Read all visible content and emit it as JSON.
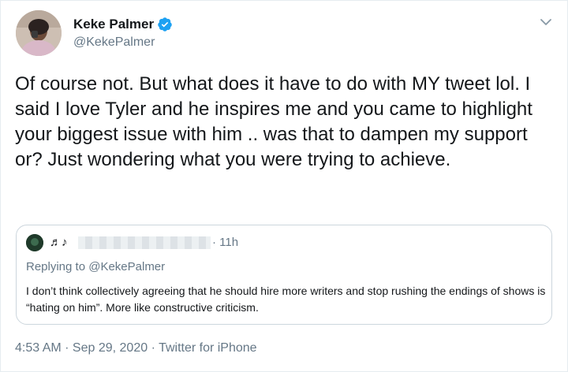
{
  "author": {
    "display_name": "Keke Palmer",
    "handle": "@KekePalmer",
    "verified": true,
    "avatar_icon": "profile-photo"
  },
  "tweet": {
    "text": "Of course not. But what does it have to do with MY tweet lol. I said I love Tyler and he inspires me and you came to highlight your biggest issue with him .. was that to dampen my support or? Just wondering what you were trying to achieve."
  },
  "quoted_tweet": {
    "name": "♬♪",
    "time": "· 11h",
    "replying_label": "Replying to ",
    "replying_to": "@KekePalmer",
    "text": "I don’t think collectively agreeing that he should hire more writers and stop rushing the endings of shows is “hating on him”. More like constructive criticism."
  },
  "meta": {
    "time": "4:53 AM",
    "sep1": " · ",
    "date": "Sep 29, 2020",
    "sep2": " · ",
    "source": "Twitter for iPhone"
  },
  "colors": {
    "text": "#14171a",
    "secondary": "#657786",
    "verified": "#1da1f2",
    "border": "#ccd6dd"
  }
}
